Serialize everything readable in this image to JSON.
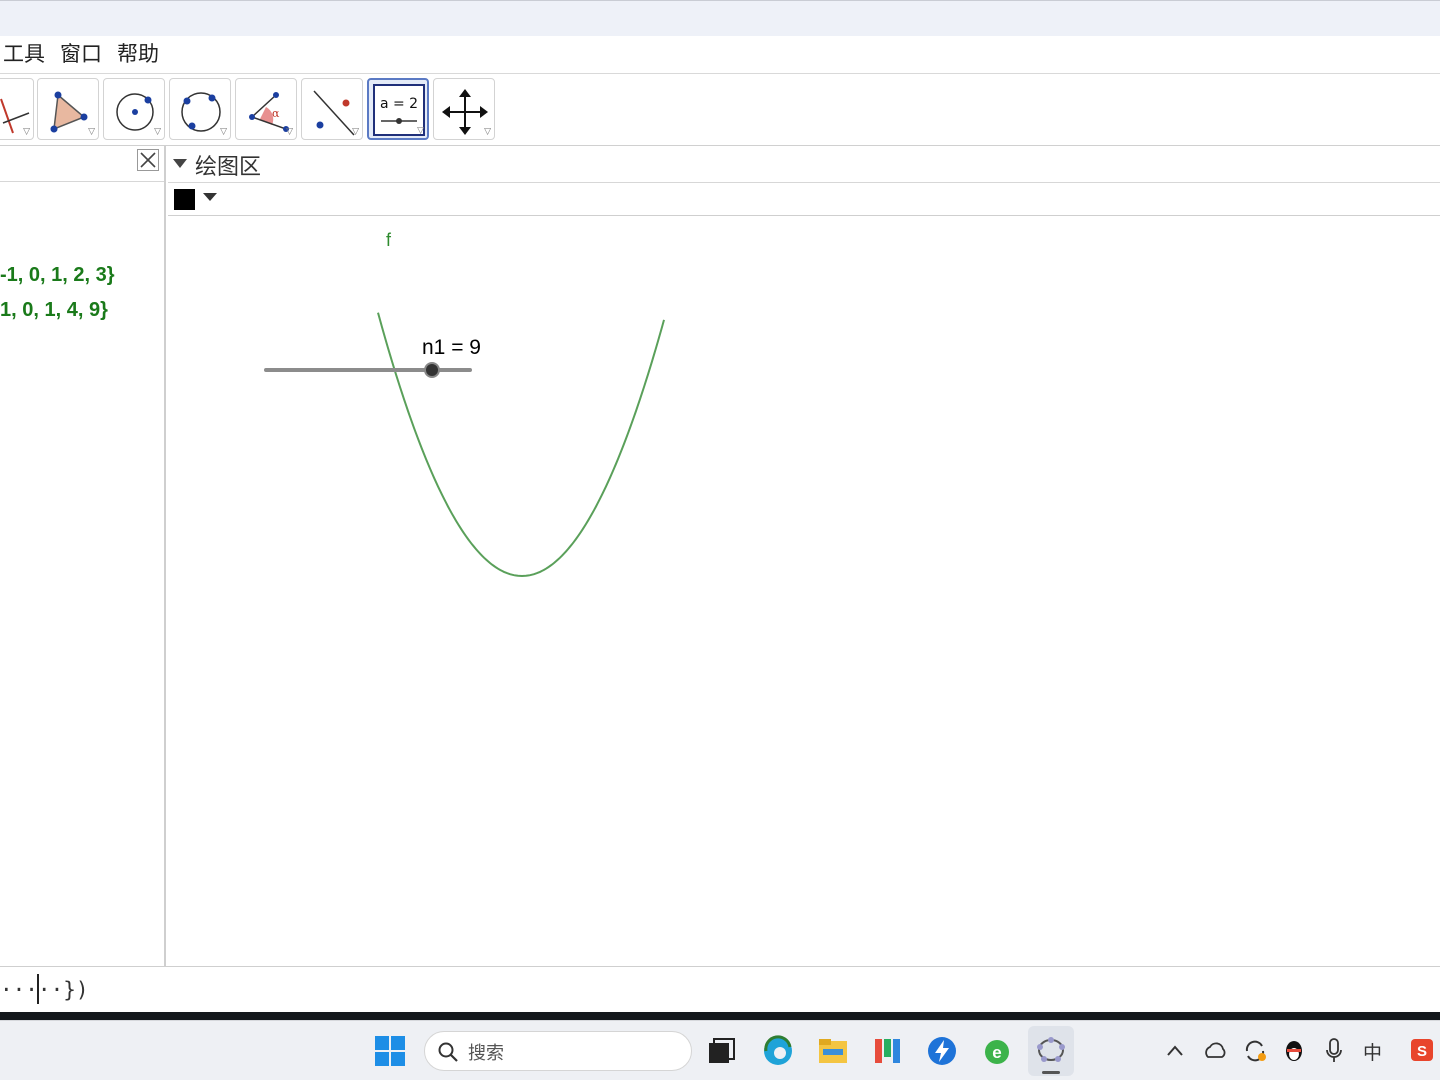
{
  "menu": {
    "tools": "工具",
    "window": "窗口",
    "help": "帮助"
  },
  "toolbar": {
    "tools": [
      "line-tool",
      "polygon-tool",
      "circle-tool",
      "circle-three-points-tool",
      "angle-tool",
      "reflect-tool",
      "slider-tool",
      "move-graphics-tool"
    ],
    "slider_icon_label": "a = 2",
    "angle_icon_label": "α",
    "selected": "slider-tool"
  },
  "algebra": {
    "rows": [
      "-1, 0, 1, 2, 3}",
      "1, 0, 1, 4, 9}"
    ]
  },
  "graphics": {
    "title": "绘图区",
    "function_label": "f",
    "slider_label": "n1 = 9",
    "slider_value": 9,
    "curve_color": "#5aa05a"
  },
  "input_bar": {
    "text": "·····})"
  },
  "taskbar": {
    "search_placeholder": "搜索",
    "tray_ime": "中"
  }
}
